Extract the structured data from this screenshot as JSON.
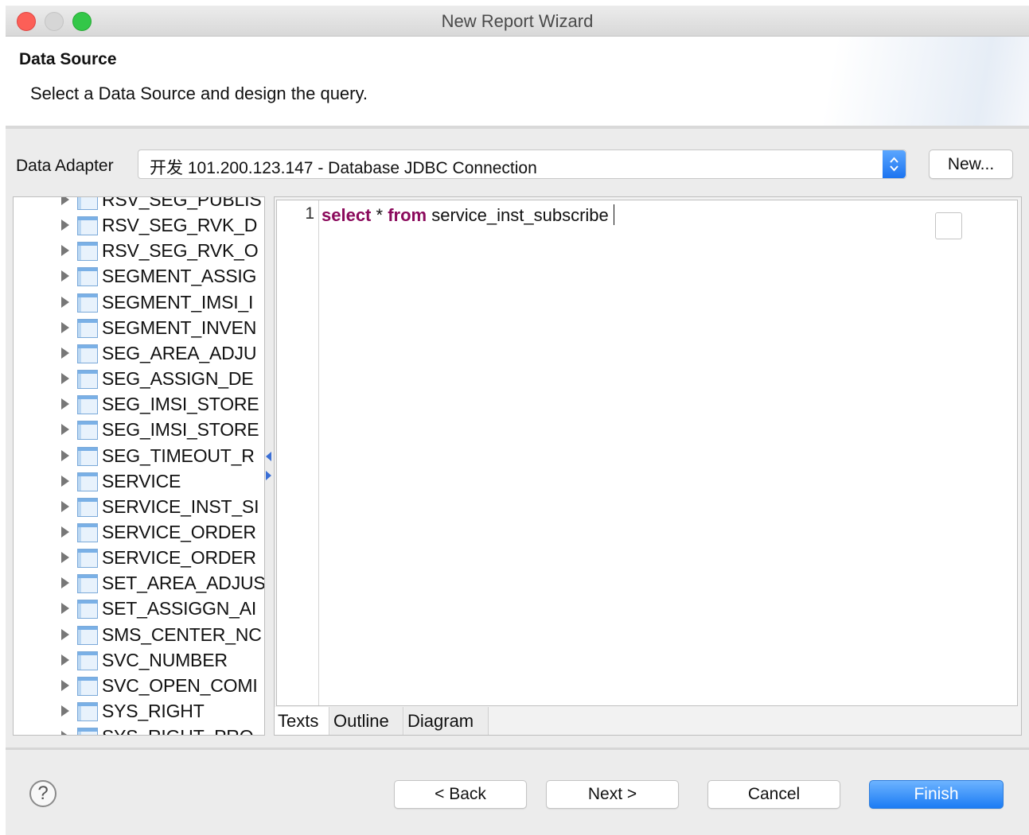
{
  "window": {
    "title": "New Report Wizard"
  },
  "header": {
    "title": "Data Source",
    "subtitle": "Select a Data Source and design the query."
  },
  "data_adapter": {
    "label": "Data Adapter",
    "value": "开发 101.200.123.147 - Database JDBC Connection",
    "new_button": "New..."
  },
  "tree": {
    "items": [
      "RSV_SEG_PUBLIS",
      "RSV_SEG_RVK_D",
      "RSV_SEG_RVK_O",
      "SEGMENT_ASSIG",
      "SEGMENT_IMSI_I",
      "SEGMENT_INVEN",
      "SEG_AREA_ADJU",
      "SEG_ASSIGN_DE",
      "SEG_IMSI_STORE",
      "SEG_IMSI_STORE",
      "SEG_TIMEOUT_R",
      "SERVICE",
      "SERVICE_INST_SI",
      "SERVICE_ORDER",
      "SERVICE_ORDER",
      "SET_AREA_ADJUS",
      "SET_ASSIGGN_AI",
      "SMS_CENTER_NC",
      "SVC_NUMBER",
      "SVC_OPEN_COMI",
      "SYS_RIGHT",
      "SYS_RIGHT_PRO"
    ]
  },
  "editor": {
    "line_number": "1",
    "kw_select": "select",
    "star": "*",
    "kw_from": "from",
    "table": "service_inst_subscribe"
  },
  "tabs": [
    "Texts",
    "Outline",
    "Diagram"
  ],
  "footer": {
    "help": "?",
    "back": "< Back",
    "next": "Next >",
    "cancel": "Cancel",
    "finish": "Finish"
  },
  "colors": {
    "accent": "#1c7cf4",
    "keyword": "#8b0a5c"
  }
}
